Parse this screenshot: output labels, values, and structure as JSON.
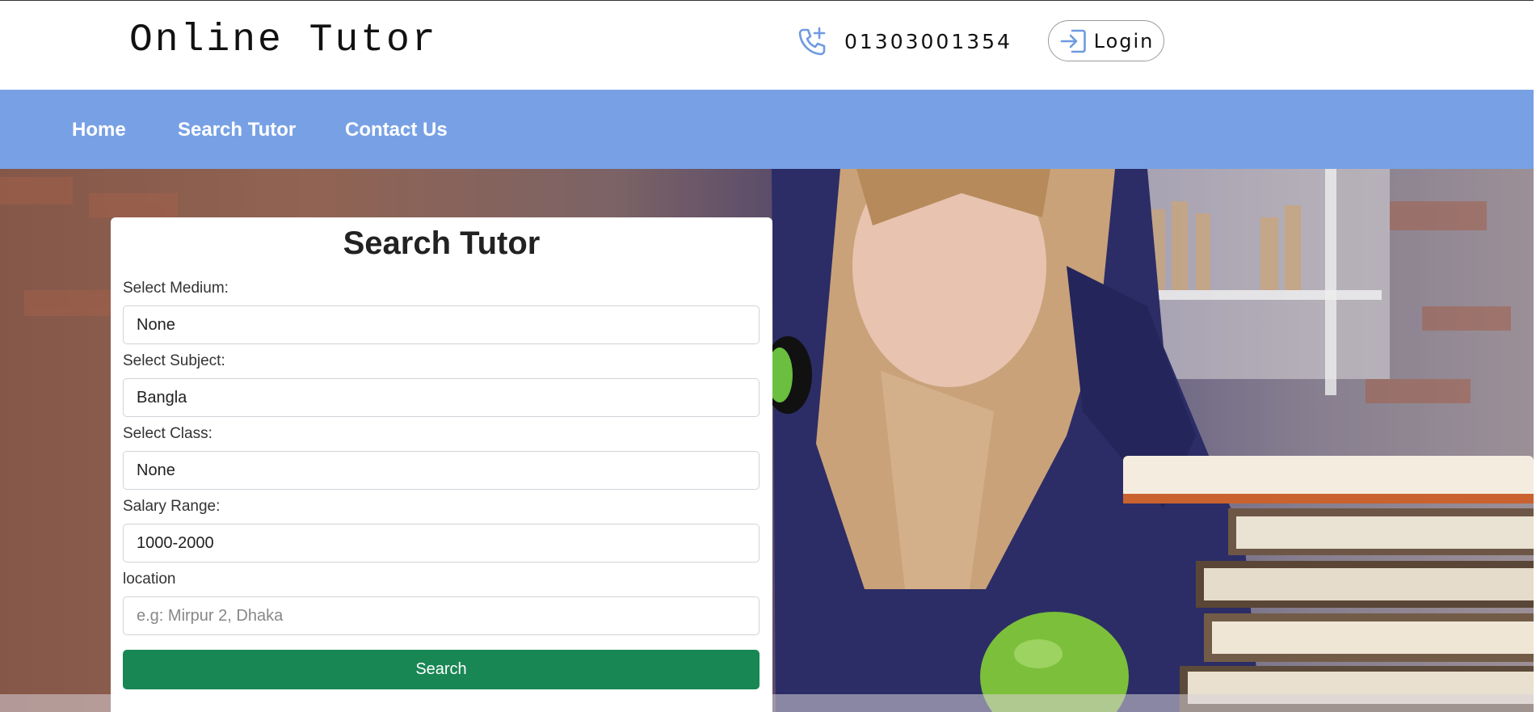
{
  "header": {
    "brand": "Online Tutor",
    "phone_icon": "phone-plus-icon",
    "phone": "01303001354",
    "login_icon": "sign-in-icon",
    "login_label": "Login"
  },
  "nav": {
    "items": [
      {
        "label": "Home"
      },
      {
        "label": "Search Tutor"
      },
      {
        "label": "Contact Us"
      }
    ]
  },
  "search_form": {
    "title": "Search Tutor",
    "medium_label": "Select Medium:",
    "medium_value": "None",
    "subject_label": "Select Subject:",
    "subject_value": "Bangla",
    "class_label": "Select Class:",
    "class_value": "None",
    "salary_label": "Salary Range:",
    "salary_value": "1000-2000",
    "location_label": "location",
    "location_placeholder": "e.g: Mirpur 2, Dhaka",
    "search_label": "Search"
  },
  "colors": {
    "nav_bg": "#78a1e5",
    "accent_icon": "#6f9ae0",
    "search_button": "#198754"
  }
}
